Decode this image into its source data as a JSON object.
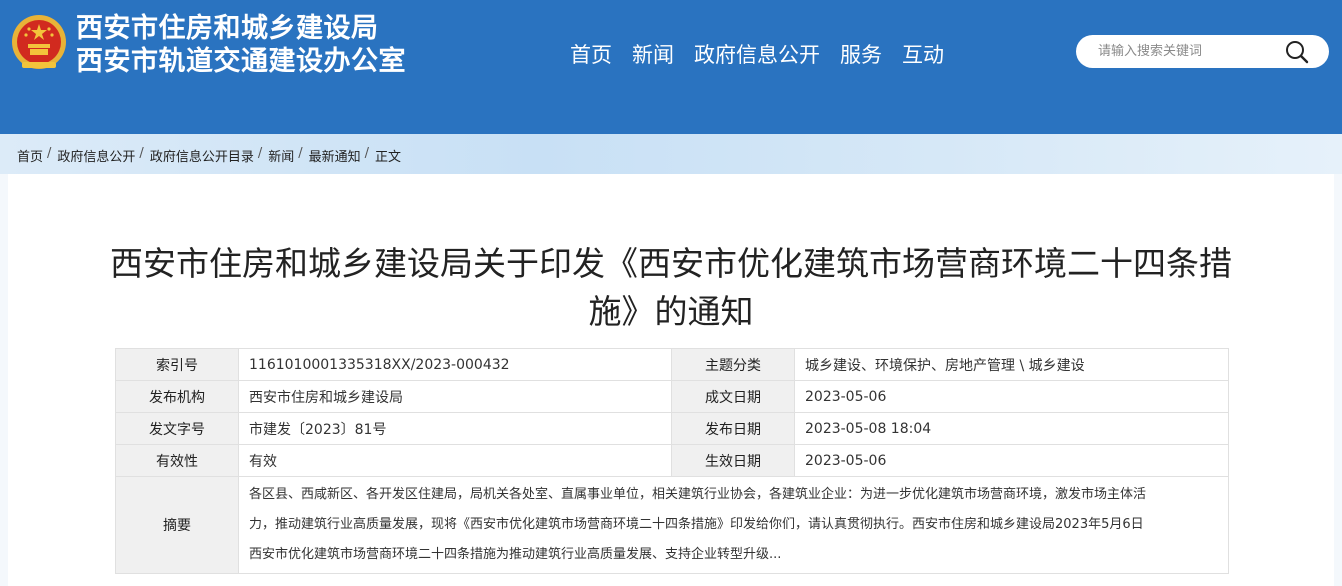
{
  "header": {
    "site_name_line1": "西安市住房和城乡建设局",
    "site_name_line2": "西安市轨道交通建设办公室",
    "nav": [
      "首页",
      "新闻",
      "政府信息公开",
      "服务",
      "互动"
    ],
    "search_placeholder": "请输入搜索关键词",
    "bg_color": "#2a73c0"
  },
  "breadcrumb": [
    "首页",
    "政府信息公开",
    "政府信息公开目录",
    "新闻",
    "最新通知",
    "正文"
  ],
  "article": {
    "title_line1": "西安市住房和城乡建设局关于印发《西安市优化建筑市场营商环境二十四条措",
    "title_line2": "施》的通知"
  },
  "meta": {
    "index_label": "索引号",
    "index_value": "1161010001335318XX/2023-000432",
    "category_label": "主题分类",
    "category_value": "城乡建设、环境保护、房地产管理 \\ 城乡建设",
    "publisher_label": "发布机构",
    "publisher_value": "西安市住房和城乡建设局",
    "created_label": "成文日期",
    "created_value": "2023-05-06",
    "docno_label": "发文字号",
    "docno_value": "市建发〔2023〕81号",
    "pubdate_label": "发布日期",
    "pubdate_value": "2023-05-08 18:04",
    "validity_label": "有效性",
    "validity_value": "有效",
    "effective_label": "生效日期",
    "effective_value": "2023-05-06",
    "abstract_label": "摘要",
    "abstract_line1": "各区县、西咸新区、各开发区住建局，局机关各处室、直属事业单位，相关建筑行业协会，各建筑业企业：为进一步优化建筑市场营商环境，激发市场主体活",
    "abstract_line2": "力，推动建筑行业高质量发展，现将《西安市优化建筑市场营商环境二十四条措施》印发给你们，请认真贯彻执行。西安市住房和城乡建设局2023年5月6日",
    "abstract_line3": "西安市优化建筑市场营商环境二十四条措施为推动建筑行业高质量发展、支持企业转型升级..."
  },
  "icons": {
    "emblem": "national-emblem-icon",
    "search": "search-icon"
  }
}
